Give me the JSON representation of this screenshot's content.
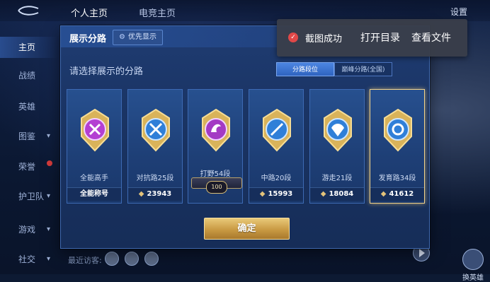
{
  "topbar": {
    "tabs": [
      "个人主页",
      "电竞主页"
    ],
    "settings": "设置"
  },
  "sidebar": {
    "items": [
      {
        "label": "主页",
        "active": true
      },
      {
        "label": "战绩"
      },
      {
        "label": "英雄"
      },
      {
        "label": "图鉴"
      },
      {
        "label": "荣誉"
      },
      {
        "label": "护卫队"
      },
      {
        "label": "游戏"
      },
      {
        "label": "社交"
      }
    ]
  },
  "dialog": {
    "title": "展示分路",
    "priority_button": "优先显示",
    "prompt": "请选择展示的分路",
    "tabs": [
      "分路段位",
      "巅峰分路(全国)"
    ],
    "cards": [
      {
        "label": "全能高手",
        "value": "全能称号",
        "color": "#c04ad8"
      },
      {
        "label": "对抗路25段",
        "value": "23943",
        "color": "#3a8fe0"
      },
      {
        "label": "打野54段",
        "value": "",
        "ribbon": "100",
        "color": "#c04ad8"
      },
      {
        "label": "中路20段",
        "value": "15993",
        "color": "#3a8fe0"
      },
      {
        "label": "游走21段",
        "value": "18084",
        "color": "#3a8fe0"
      },
      {
        "label": "发育路34段",
        "value": "41612",
        "color": "#3a8fe0",
        "selected": true
      }
    ],
    "confirm": "确定"
  },
  "toast": {
    "message": "截图成功",
    "actions": [
      "打开目录",
      "查看文件"
    ]
  },
  "bottom": {
    "hint": "最近访客:",
    "hero_switch": "换英雄"
  }
}
